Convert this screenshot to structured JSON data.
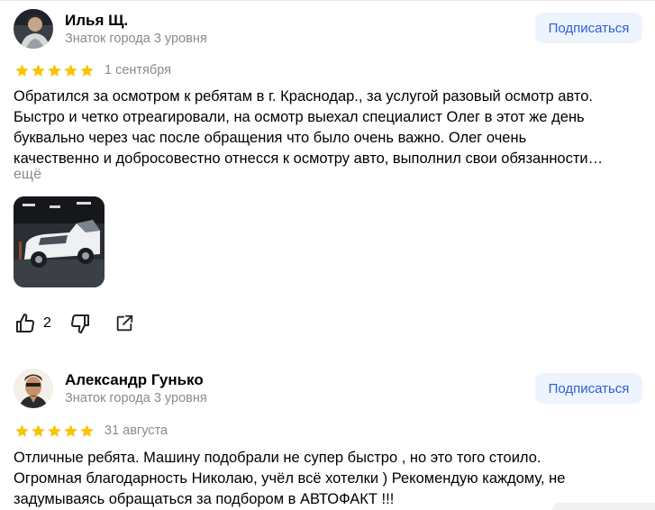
{
  "reviews": [
    {
      "author": "Илья Щ.",
      "level": "Знаток города 3 уровня",
      "subscribe_label": "Подписаться",
      "rating": 5,
      "date": "1 сентября",
      "text_lines": [
        "Обратился за осмотром к ребятам в г. Краснодар., за услугой разовый осмотр авто.",
        "Быстро и четко отреагировали, на осмотр выехал специалист Олег в этот же день",
        "буквально через час после обращения что было очень важно. Олег очень",
        "качественно и добросовестно отнесся к осмотру авто, выполнил свои обязанности…"
      ],
      "more_label": "ещё",
      "like_count": "2"
    },
    {
      "author": "Александр Гунько",
      "level": "Знаток города 3 уровня",
      "subscribe_label": "Подписаться",
      "rating": 5,
      "date": "31 августа",
      "text_lines": [
        "Отличные ребята. Машину подобрали не супер быстро , но это того стоило.",
        "Огромная благодарность Николаю, учёл всё хотелки ) Рекомендую каждому, не",
        "задумываясь обращаться за подбором в АВТОФАКТ !!!"
      ]
    }
  ],
  "colors": {
    "star": "#f9c400",
    "subscribe_bg": "#eef4fd",
    "subscribe_text": "#2b5fd6",
    "muted": "#8a8a8a"
  },
  "icons": [
    "thumbs-up-icon",
    "thumbs-down-icon",
    "share-icon",
    "star-icon"
  ]
}
